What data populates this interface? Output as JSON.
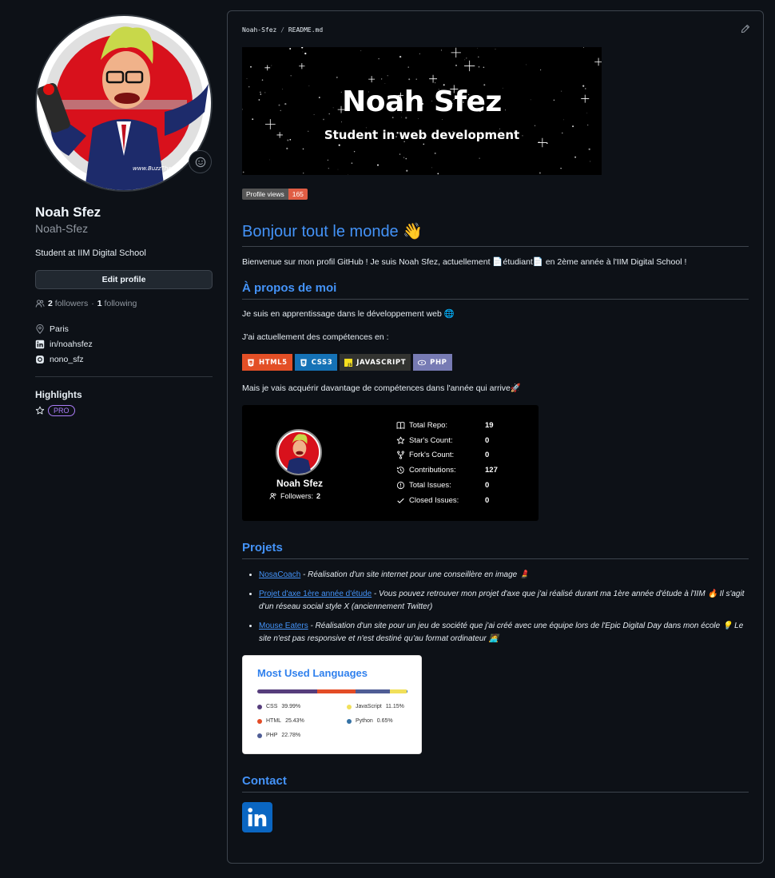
{
  "profile": {
    "name": "Noah Sfez",
    "login": "Noah-Sfez",
    "bio": "Student at IIM Digital School",
    "edit_label": "Edit profile",
    "followers_count": "2",
    "followers_label": "followers",
    "following_count": "1",
    "following_label": "following",
    "dot": "·",
    "location": "Paris",
    "linkedin": "in/noahsfez",
    "instagram": "nono_sfz",
    "highlights_title": "Highlights",
    "pro_label": "PRO"
  },
  "readme": {
    "owner": "Noah-Sfez",
    "separator": "/",
    "file": "README.md",
    "banner_title": "Noah Sfez",
    "banner_subtitle": "Student in web development",
    "views_label": "Profile views",
    "views_count": "165",
    "greeting": "Bonjour tout le monde",
    "greeting_emoji": "👋",
    "intro": "Bienvenue sur mon profil GitHub ! Je suis Noah Sfez, actuellement 📄étudiant📄 en 2ème année à l'IIM Digital School !",
    "about_title": "À propos de moi",
    "about_text": "Je suis en apprentissage dans le développement web 🌐",
    "skills_text": "J'ai actuellement des compétences en :",
    "badges": [
      {
        "label": "HTML5",
        "color": "#e34f26",
        "icon": "html5-icon"
      },
      {
        "label": "CSS3",
        "color": "#1572b6",
        "icon": "css3-icon"
      },
      {
        "label": "JAVASCRIPT",
        "color": "#323330",
        "icon": "javascript-icon"
      },
      {
        "label": "PHP",
        "color": "#777bb4",
        "icon": "php-icon"
      }
    ],
    "future_text": "Mais je vais acquérir davantage de compétences dans l'année qui arrive🚀",
    "stats": {
      "name": "Noah Sfez",
      "followers_label": "Followers:",
      "followers_value": "2",
      "rows": [
        {
          "label": "Total Repo:",
          "value": "19",
          "icon": "repo-icon"
        },
        {
          "label": "Star's Count:",
          "value": "0",
          "icon": "star-icon"
        },
        {
          "label": "Fork's Count:",
          "value": "0",
          "icon": "fork-icon"
        },
        {
          "label": "Contributions:",
          "value": "127",
          "icon": "history-icon"
        },
        {
          "label": "Total Issues:",
          "value": "0",
          "icon": "issue-icon"
        },
        {
          "label": "Closed Issues:",
          "value": "0",
          "icon": "check-icon"
        }
      ]
    },
    "projects_title": "Projets",
    "projects": [
      {
        "link": "NosaCoach",
        "desc": " - Réalisation d'un site internet pour une conseillère en image 💄"
      },
      {
        "link": "Projet d'axe 1ère année d'étude",
        "desc": " - Vous pouvez retrouver mon projet d'axe que j'ai réalisé durant ma 1ère année d'étude à l'IIM 🔥 Il s'agit d'un réseau social style X (anciennement Twitter)"
      },
      {
        "link": "Mouse Eaters",
        "desc": " - Réalisation d'un site pour un jeu de société que j'ai créé avec une équipe lors de l'Epic Digital Day dans mon école 💡 Le site n'est pas responsive et n'est destiné qu'au format ordinateur 🧑‍💻"
      }
    ],
    "languages": {
      "title": "Most Used Languages",
      "items": [
        {
          "name": "CSS",
          "percent": "39.99%",
          "value": 39.99,
          "color": "#563d7c"
        },
        {
          "name": "HTML",
          "percent": "25.43%",
          "value": 25.43,
          "color": "#e34c26"
        },
        {
          "name": "PHP",
          "percent": "22.78%",
          "value": 22.78,
          "color": "#4f5d95"
        },
        {
          "name": "JavaScript",
          "percent": "11.15%",
          "value": 11.15,
          "color": "#f1e05a"
        },
        {
          "name": "Python",
          "percent": "0.65%",
          "value": 0.65,
          "color": "#3572a5"
        }
      ]
    },
    "contact_title": "Contact"
  }
}
